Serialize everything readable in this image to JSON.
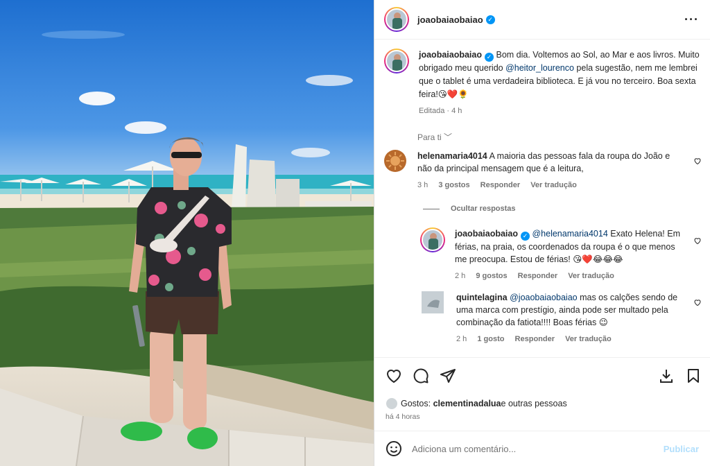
{
  "post": {
    "username": "joaobaiaobaiao",
    "verified": true,
    "caption_pre": "Bom dia. Voltemos ao Sol, ao Mar e aos livros. Muito obrigado meu querido ",
    "caption_mention": "@heitor_lourenco",
    "caption_post": " pela sugestão, nem me lembrei que o tablet é uma verdadeira biblioteca. E já vou no terceiro. Boa sexta feira!",
    "caption_emojis": "😘❤️🌻",
    "edited": "Editada",
    "age": "4 h",
    "for_you": "Para ti"
  },
  "comments": [
    {
      "username": "helenamaria4014",
      "text": "A maioria das pessoas fala da roupa do João e não da principal mensagem que é a leitura,",
      "age": "3 h",
      "likes": "3 gostos",
      "reply": "Responder",
      "translate": "Ver tradução",
      "avatar_color": "#b8692b"
    }
  ],
  "hide_replies": "Ocultar respostas",
  "replies": [
    {
      "username": "joaobaiaobaiao",
      "mention": "@helenamaria4014",
      "text": " Exato Helena! Em férias, na praia, os coordenados da roupa é o que menos me preocupa. Estou de férias!",
      "emojis": "😘❤️😂😂😂",
      "age": "2 h",
      "likes": "9 gostos",
      "reply": "Responder",
      "translate": "Ver tradução"
    },
    {
      "username": "quintelagina",
      "mention": "@joaobaiaobaiao",
      "text": " mas os calções sendo de uma marca com prestígio, ainda pode ser multado pela combinação da fatiota!!!! Boas férias",
      "emojis": "😉",
      "age": "2 h",
      "likes": "1 gosto",
      "reply": "Responder",
      "translate": "Ver tradução"
    }
  ],
  "footer": {
    "likes_prefix": "Gostos: ",
    "likes_user": "clementinadalua",
    "likes_suffix": " e outras pessoas",
    "time": "há 4 horas",
    "comment_placeholder": "Adiciona um comentário...",
    "publish": "Publicar"
  },
  "icons": [
    "heart-icon",
    "comment-icon",
    "share-icon",
    "save-icon",
    "download-icon",
    "emoji-icon",
    "more-icon",
    "verified-icon"
  ]
}
